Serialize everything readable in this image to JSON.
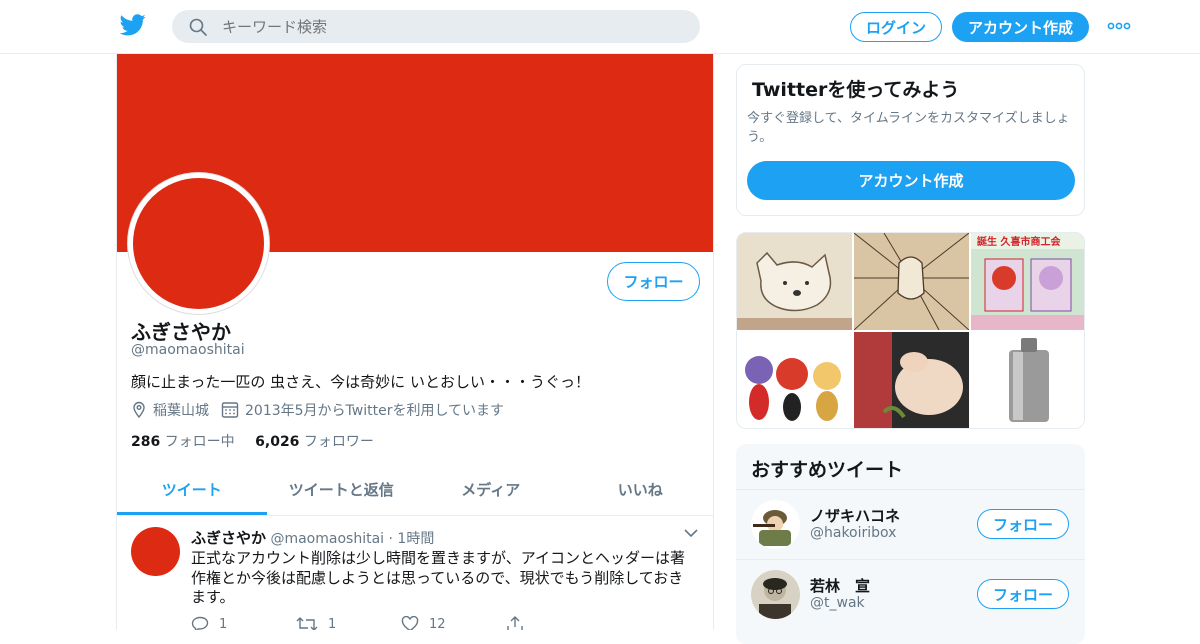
{
  "header": {
    "search_placeholder": "キーワード検索",
    "login_label": "ログイン",
    "signup_label": "アカウント作成"
  },
  "profile": {
    "name": "ふぎさやか",
    "handle": "@maomaoshitai",
    "bio": "顔に止まった一匹の 虫さえ、今は奇妙に いとおしい・・・うぐっ！",
    "location": "稲葉山城",
    "joined": "2013年5月からTwitterを利用しています",
    "following_count": "286",
    "following_label": "フォロー中",
    "followers_count": "6,026",
    "followers_label": "フォロワー",
    "follow_label": "フォロー",
    "header_color": "#dd2a13"
  },
  "tabs": [
    {
      "label": "ツイート",
      "active": true
    },
    {
      "label": "ツイートと返信",
      "active": false
    },
    {
      "label": "メディア",
      "active": false
    },
    {
      "label": "いいね",
      "active": false
    }
  ],
  "tweet": {
    "name": "ふぎさやか",
    "handle": "@maomaoshitai",
    "separator": "·",
    "time": "1時間",
    "text": "正式なアカウント削除は少し時間を置きますが、アイコンとヘッダーは著作権とか今後は配慮しようとは思っているので、現状でもう削除しておきます。",
    "replies": "1",
    "retweets": "1",
    "likes": "12"
  },
  "signup_card": {
    "title": "Twitterを使ってみよう",
    "desc": "今すぐ登録して、タイムラインをカスタマイズしましょう。",
    "button": "アカウント作成"
  },
  "photo_grid": {
    "label_banner": "誕生 久喜市商工会"
  },
  "recommended": {
    "title": "おすすめツイート",
    "follow_label": "フォロー",
    "items": [
      {
        "name": "ノザキハコネ",
        "handle": "@hakoiribox"
      },
      {
        "name": "若林　宣",
        "handle": "@t_wak"
      }
    ]
  },
  "colors": {
    "accent": "#1da1f2",
    "brand_red": "#dd2a13"
  }
}
